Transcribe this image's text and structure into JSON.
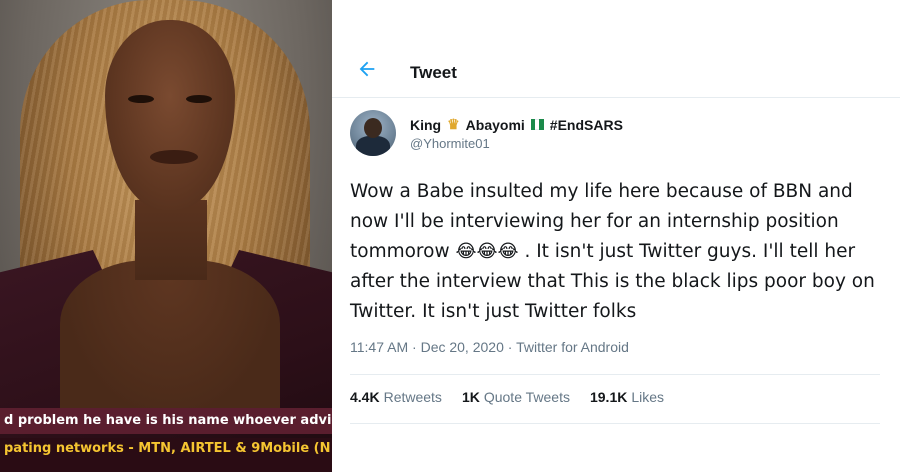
{
  "header": {
    "title": "Tweet"
  },
  "author": {
    "name_first": "King",
    "name_last": "Abayomi",
    "hashtag": "#EndSARS",
    "handle": "@Yhormite01"
  },
  "tweet": {
    "text_part1": "Wow a Babe insulted my life here because of BBN and now I'll be interviewing her for an internship position tommorow ",
    "emojis": "😂😂😂",
    "text_part2": " . It isn't just Twitter guys. I'll tell her after the interview that This is the black lips poor boy on Twitter. It isn't just Twitter folks",
    "time": "11:47 AM",
    "date": "Dec 20, 2020",
    "source": "Twitter for Android"
  },
  "stats": {
    "retweets_count": "4.4K",
    "retweets_label": "Retweets",
    "quotes_count": "1K",
    "quotes_label": "Quote Tweets",
    "likes_count": "19.1K",
    "likes_label": "Likes"
  },
  "photo": {
    "ticker_line1": "d problem he have is his name whoever advic",
    "ticker_line2": "pating networks - MTN, AIRTEL & 9Mobile (N"
  },
  "colors": {
    "accent": "#1da1f2",
    "text": "#14171a",
    "muted": "#657786",
    "ticker_yellow": "#f5c531"
  },
  "icons": {
    "back": "arrow-left-icon",
    "crown": "crown-emoji-icon",
    "flag": "nigeria-flag-icon"
  }
}
